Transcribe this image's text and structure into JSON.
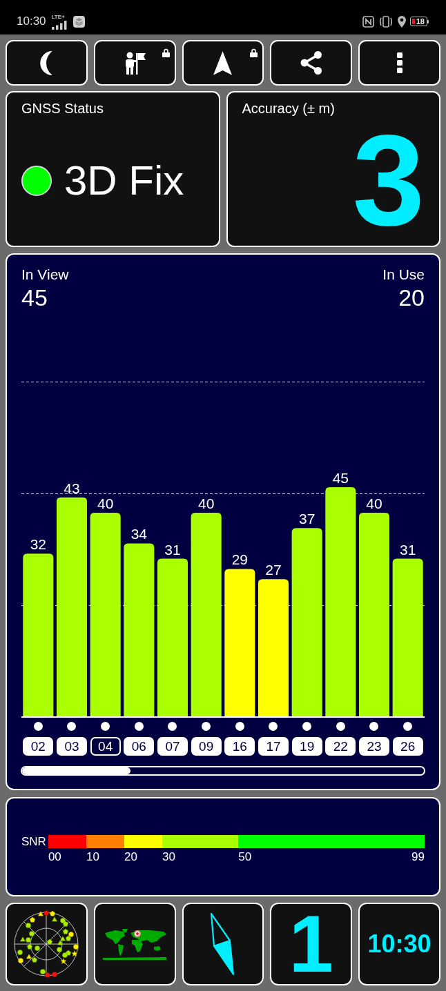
{
  "status_bar": {
    "time": "10:30",
    "network": "LTE+",
    "battery": "18"
  },
  "toolbar": [
    {
      "kind": "moon",
      "locked": false
    },
    {
      "kind": "person_flag",
      "locked": true
    },
    {
      "kind": "arrow",
      "locked": true
    },
    {
      "kind": "share",
      "locked": false
    },
    {
      "kind": "more",
      "locked": false
    }
  ],
  "gnss_status": {
    "title": "GNSS Status",
    "color": "#00ff00",
    "fix": "3D Fix"
  },
  "accuracy": {
    "title": "Accuracy (± m)",
    "value": "3"
  },
  "satellites_panel": {
    "in_view_label": "In View",
    "in_view": "45",
    "in_use_label": "In Use",
    "in_use": "20",
    "chart_data": {
      "type": "bar",
      "stacked": true,
      "data_labels": true,
      "categories": [
        "02",
        "03",
        "04",
        "06",
        "07",
        "09",
        "16",
        "17",
        "19",
        "22",
        "23",
        "26"
      ],
      "series": [
        {
          "color": "#aaff00",
          "values": [
            32,
            43,
            40,
            34,
            31,
            40,
            null,
            null,
            37,
            45,
            40,
            31
          ]
        },
        {
          "color": "#ffff00",
          "values": [
            null,
            null,
            null,
            null,
            null,
            null,
            29,
            27,
            null,
            null,
            null,
            null
          ]
        }
      ]
    },
    "satellites": [
      {
        "in_use": true,
        "selected": false
      },
      {
        "in_use": true,
        "selected": false
      },
      {
        "in_use": true,
        "selected": true
      },
      {
        "in_use": true,
        "selected": false
      },
      {
        "in_use": true,
        "selected": false
      },
      {
        "in_use": true,
        "selected": false
      },
      {
        "in_use": true,
        "selected": false
      },
      {
        "in_use": true,
        "selected": false
      },
      {
        "in_use": true,
        "selected": false
      },
      {
        "in_use": true,
        "selected": false
      },
      {
        "in_use": true,
        "selected": false
      },
      {
        "in_use": true,
        "selected": false
      }
    ]
  },
  "snr_legend": {
    "label": "SNR",
    "segments": [
      {
        "color": "#ff0000"
      },
      {
        "color": "#ff8000"
      },
      {
        "color": "#ffff00"
      },
      {
        "color": "#aaff00"
      },
      {
        "color": "#00ff00"
      }
    ],
    "ticks": [
      "00",
      "10",
      "20",
      "30",
      "50",
      "99"
    ]
  },
  "tiles": [
    {
      "kind": "sky_plot"
    },
    {
      "kind": "world_map"
    },
    {
      "kind": "compass"
    },
    {
      "kind": "number",
      "value": "1"
    },
    {
      "kind": "clock",
      "value": "10:30"
    }
  ]
}
